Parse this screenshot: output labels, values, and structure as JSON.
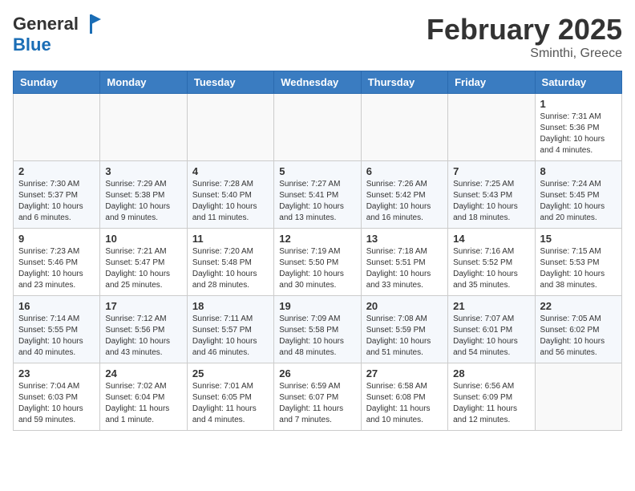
{
  "header": {
    "logo_line1": "General",
    "logo_line2": "Blue",
    "month": "February 2025",
    "location": "Sminthi, Greece"
  },
  "weekdays": [
    "Sunday",
    "Monday",
    "Tuesday",
    "Wednesday",
    "Thursday",
    "Friday",
    "Saturday"
  ],
  "weeks": [
    [
      {
        "day": "",
        "info": ""
      },
      {
        "day": "",
        "info": ""
      },
      {
        "day": "",
        "info": ""
      },
      {
        "day": "",
        "info": ""
      },
      {
        "day": "",
        "info": ""
      },
      {
        "day": "",
        "info": ""
      },
      {
        "day": "1",
        "info": "Sunrise: 7:31 AM\nSunset: 5:36 PM\nDaylight: 10 hours and 4 minutes."
      }
    ],
    [
      {
        "day": "2",
        "info": "Sunrise: 7:30 AM\nSunset: 5:37 PM\nDaylight: 10 hours and 6 minutes."
      },
      {
        "day": "3",
        "info": "Sunrise: 7:29 AM\nSunset: 5:38 PM\nDaylight: 10 hours and 9 minutes."
      },
      {
        "day": "4",
        "info": "Sunrise: 7:28 AM\nSunset: 5:40 PM\nDaylight: 10 hours and 11 minutes."
      },
      {
        "day": "5",
        "info": "Sunrise: 7:27 AM\nSunset: 5:41 PM\nDaylight: 10 hours and 13 minutes."
      },
      {
        "day": "6",
        "info": "Sunrise: 7:26 AM\nSunset: 5:42 PM\nDaylight: 10 hours and 16 minutes."
      },
      {
        "day": "7",
        "info": "Sunrise: 7:25 AM\nSunset: 5:43 PM\nDaylight: 10 hours and 18 minutes."
      },
      {
        "day": "8",
        "info": "Sunrise: 7:24 AM\nSunset: 5:45 PM\nDaylight: 10 hours and 20 minutes."
      }
    ],
    [
      {
        "day": "9",
        "info": "Sunrise: 7:23 AM\nSunset: 5:46 PM\nDaylight: 10 hours and 23 minutes."
      },
      {
        "day": "10",
        "info": "Sunrise: 7:21 AM\nSunset: 5:47 PM\nDaylight: 10 hours and 25 minutes."
      },
      {
        "day": "11",
        "info": "Sunrise: 7:20 AM\nSunset: 5:48 PM\nDaylight: 10 hours and 28 minutes."
      },
      {
        "day": "12",
        "info": "Sunrise: 7:19 AM\nSunset: 5:50 PM\nDaylight: 10 hours and 30 minutes."
      },
      {
        "day": "13",
        "info": "Sunrise: 7:18 AM\nSunset: 5:51 PM\nDaylight: 10 hours and 33 minutes."
      },
      {
        "day": "14",
        "info": "Sunrise: 7:16 AM\nSunset: 5:52 PM\nDaylight: 10 hours and 35 minutes."
      },
      {
        "day": "15",
        "info": "Sunrise: 7:15 AM\nSunset: 5:53 PM\nDaylight: 10 hours and 38 minutes."
      }
    ],
    [
      {
        "day": "16",
        "info": "Sunrise: 7:14 AM\nSunset: 5:55 PM\nDaylight: 10 hours and 40 minutes."
      },
      {
        "day": "17",
        "info": "Sunrise: 7:12 AM\nSunset: 5:56 PM\nDaylight: 10 hours and 43 minutes."
      },
      {
        "day": "18",
        "info": "Sunrise: 7:11 AM\nSunset: 5:57 PM\nDaylight: 10 hours and 46 minutes."
      },
      {
        "day": "19",
        "info": "Sunrise: 7:09 AM\nSunset: 5:58 PM\nDaylight: 10 hours and 48 minutes."
      },
      {
        "day": "20",
        "info": "Sunrise: 7:08 AM\nSunset: 5:59 PM\nDaylight: 10 hours and 51 minutes."
      },
      {
        "day": "21",
        "info": "Sunrise: 7:07 AM\nSunset: 6:01 PM\nDaylight: 10 hours and 54 minutes."
      },
      {
        "day": "22",
        "info": "Sunrise: 7:05 AM\nSunset: 6:02 PM\nDaylight: 10 hours and 56 minutes."
      }
    ],
    [
      {
        "day": "23",
        "info": "Sunrise: 7:04 AM\nSunset: 6:03 PM\nDaylight: 10 hours and 59 minutes."
      },
      {
        "day": "24",
        "info": "Sunrise: 7:02 AM\nSunset: 6:04 PM\nDaylight: 11 hours and 1 minute."
      },
      {
        "day": "25",
        "info": "Sunrise: 7:01 AM\nSunset: 6:05 PM\nDaylight: 11 hours and 4 minutes."
      },
      {
        "day": "26",
        "info": "Sunrise: 6:59 AM\nSunset: 6:07 PM\nDaylight: 11 hours and 7 minutes."
      },
      {
        "day": "27",
        "info": "Sunrise: 6:58 AM\nSunset: 6:08 PM\nDaylight: 11 hours and 10 minutes."
      },
      {
        "day": "28",
        "info": "Sunrise: 6:56 AM\nSunset: 6:09 PM\nDaylight: 11 hours and 12 minutes."
      },
      {
        "day": "",
        "info": ""
      }
    ]
  ]
}
